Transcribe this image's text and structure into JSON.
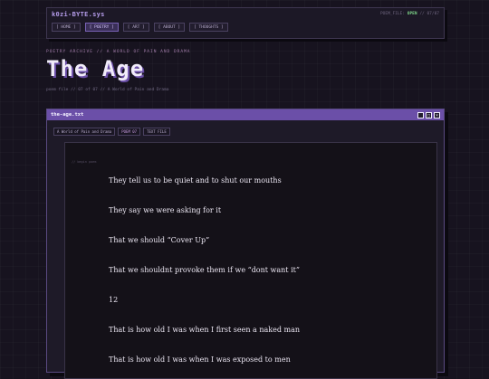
{
  "site": {
    "title": "k0zi-BYTE.sys",
    "status_prefix": "POEM_FILE:",
    "status_value": "OPEN",
    "status_suffix": "// 07/07",
    "nav": [
      "[ HOME ]",
      "[ POETRY ]",
      "[ ART ]",
      "[ ABOUT ]",
      "[ THOUGHTS ]"
    ],
    "nav_active_index": 1
  },
  "header": {
    "kicker": "POETRY ARCHIVE // A WORLD OF PAIN AND DRAMA",
    "title": "The Age",
    "meta": "poem file // 07 of 07 // A World of Pain and Drama"
  },
  "window": {
    "title": "the-age.txt",
    "controls": [
      "_",
      "□",
      "×"
    ],
    "toolbar": [
      "A World of Pain and Drama",
      "POEM 07",
      "TEXT FILE"
    ],
    "file_label": "// begin poem",
    "lines": [
      "They tell us to be quiet and to shut our mouths",
      "They say we were asking for it",
      "That we should “Cover Up”",
      "That we shouldnt provoke them if we “dont want it”",
      "12",
      "That is how old I was when I first seen a naked man",
      "That is how old I was when I was exposed to men"
    ]
  },
  "colors": {
    "background": "#17131f",
    "accent": "#6b4fa8",
    "title_text": "#b59cea",
    "status_ok": "#7fd68a"
  }
}
